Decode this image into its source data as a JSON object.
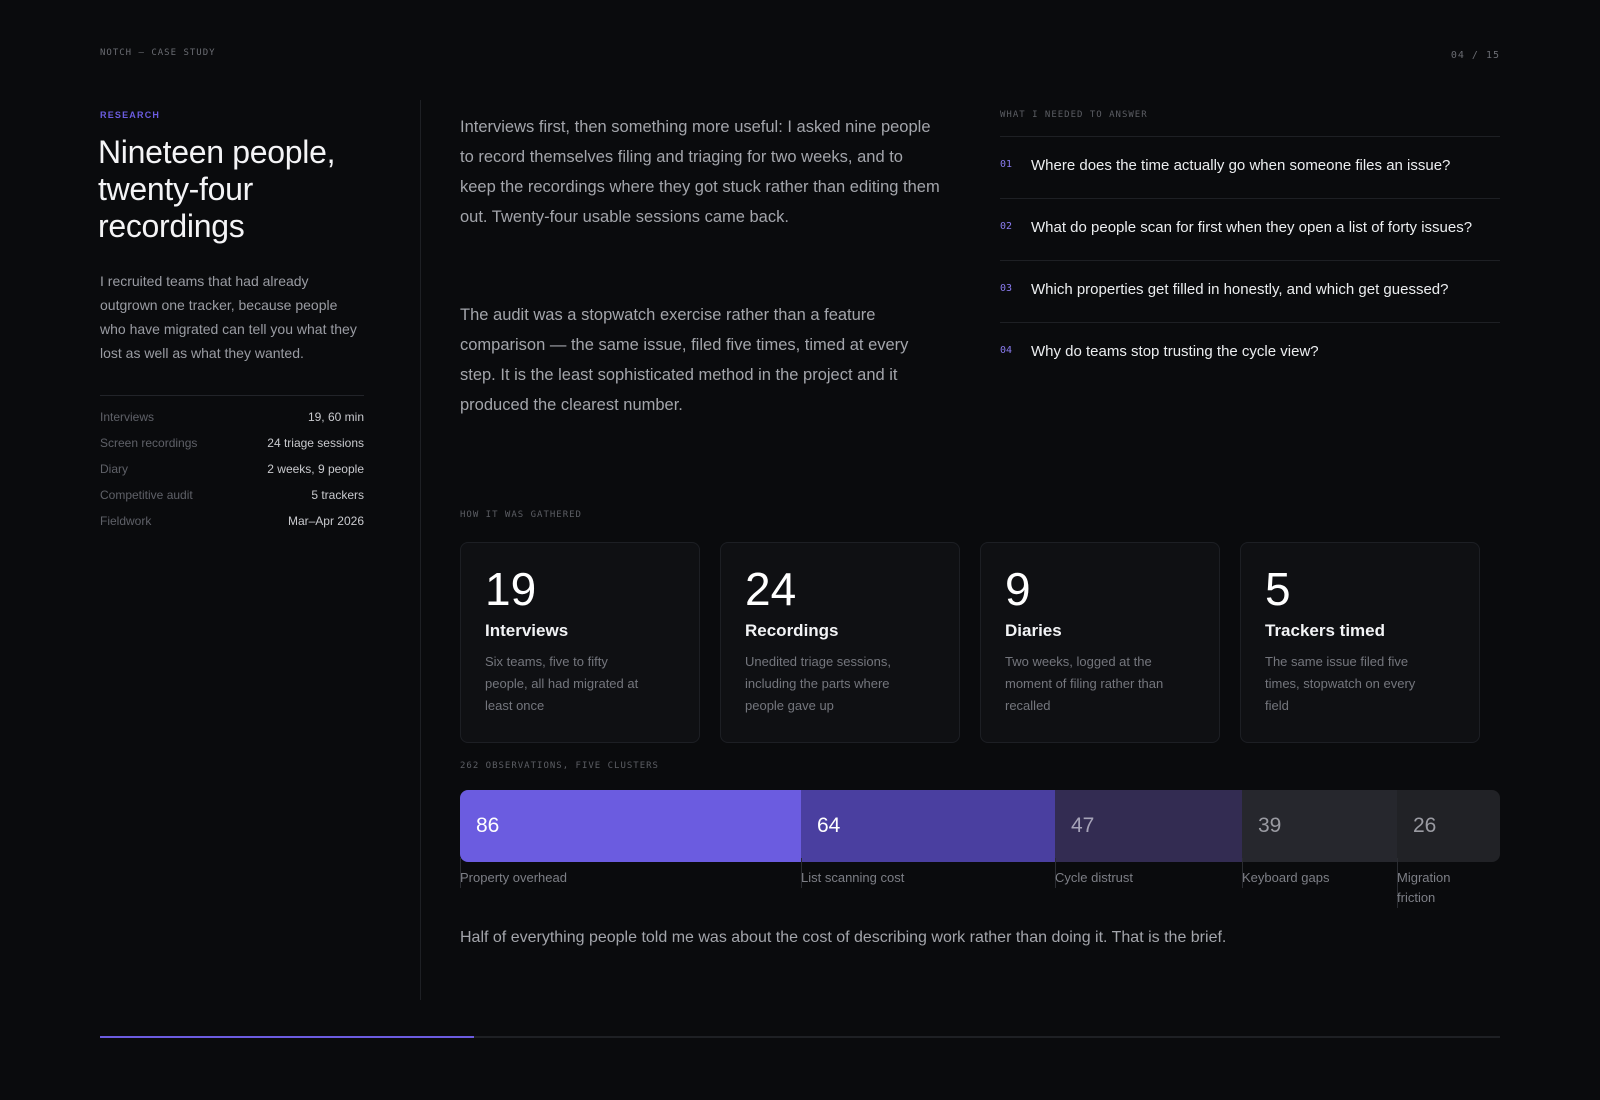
{
  "header": {
    "eyebrow": "NOTCH — CASE STUDY",
    "page_counter": "04 / 15"
  },
  "left": {
    "section_label": "RESEARCH",
    "title": "Nineteen people, twenty-four recordings",
    "intro": "I recruited teams that had already outgrown one tracker, because people who have migrated can tell you what they lost as well as what they wanted.",
    "meta": [
      {
        "key": "Interviews",
        "value": "19, 60 min"
      },
      {
        "key": "Screen recordings",
        "value": "24 triage sessions"
      },
      {
        "key": "Diary",
        "value": "2 weeks, 9 people"
      },
      {
        "key": "Competitive audit",
        "value": "5 trackers"
      },
      {
        "key": "Fieldwork",
        "value": "Mar–Apr 2026"
      }
    ]
  },
  "body": {
    "paragraph_1": "Interviews first, then something more useful: I asked nine people to record themselves filing and triaging for two weeks, and to keep the recordings where they got stuck rather than editing them out. Twenty-four usable sessions came back.",
    "paragraph_2": "The audit was a stopwatch exercise rather than a feature comparison — the same issue, filed five times, timed at every step. It is the least sophisticated method in the project and it produced the clearest number."
  },
  "questions": {
    "label": "WHAT I NEEDED TO ANSWER",
    "items": [
      {
        "num": "01",
        "text": "Where does the time actually go when someone files an issue?"
      },
      {
        "num": "02",
        "text": "What do people scan for first when they open a list of forty issues?"
      },
      {
        "num": "03",
        "text": "Which properties get filled in honestly, and which get guessed?"
      },
      {
        "num": "04",
        "text": "Why do teams stop trusting the cycle view?"
      }
    ]
  },
  "gathered": {
    "label": "HOW IT WAS GATHERED",
    "cards": [
      {
        "number": "19",
        "title": "Interviews",
        "desc": "Six teams, five to fifty people, all had migrated at least once"
      },
      {
        "number": "24",
        "title": "Recordings",
        "desc": "Unedited triage sessions, including the parts where people gave up"
      },
      {
        "number": "9",
        "title": "Diaries",
        "desc": "Two weeks, logged at the moment of filing rather than recalled"
      },
      {
        "number": "5",
        "title": "Trackers timed",
        "desc": "The same issue filed five times, stopwatch on every field"
      }
    ]
  },
  "observations": {
    "label": "262 OBSERVATIONS, FIVE CLUSTERS",
    "clusters": [
      {
        "label": "Property overhead",
        "value": 86,
        "color": "#6b5ce0",
        "text_color": "#ffffff"
      },
      {
        "label": "List scanning cost",
        "value": 64,
        "color": "#4a3fa0",
        "text_color": "#ffffff"
      },
      {
        "label": "Cycle distrust",
        "value": 47,
        "color": "#332c52",
        "text_color": "#a6a3b8"
      },
      {
        "label": "Keyboard gaps",
        "value": 39,
        "color": "#26272d",
        "text_color": "#9a9ba2"
      },
      {
        "label": "Migration friction",
        "value": 26,
        "color": "#212226",
        "text_color": "#9a9ba2"
      }
    ]
  },
  "conclusion": "Half of everything people told me was about the cost of describing work rather than doing it. That is the brief.",
  "progress": {
    "current": 4,
    "total": 15,
    "fraction": 0.267
  },
  "colors": {
    "accent": "#6b5ce0",
    "background": "#0a0b0d"
  }
}
